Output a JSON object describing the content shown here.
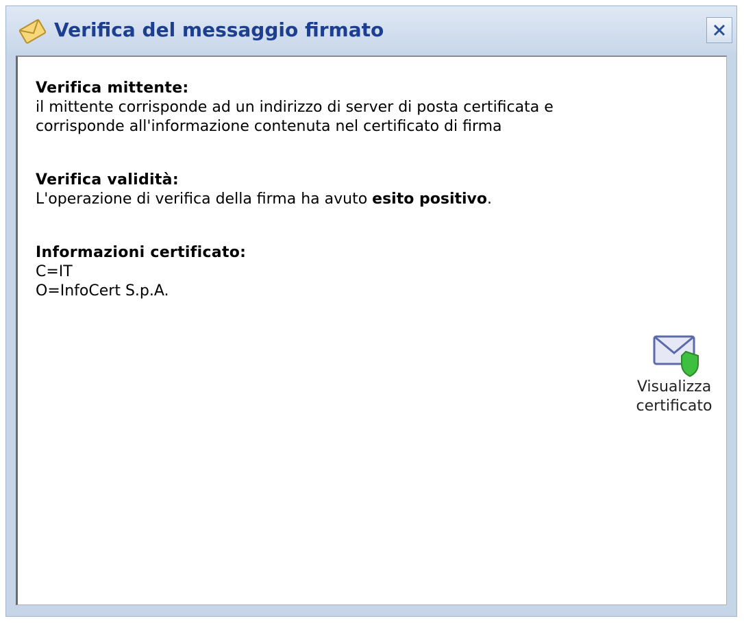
{
  "window": {
    "title": "Verifica del messaggio firmato",
    "close_label": "Close"
  },
  "sections": {
    "sender": {
      "heading": "Verifica mittente:",
      "line1": "il mittente corrisponde ad un indirizzo di server di posta certificata e",
      "line2": "corrisponde all'informazione contenuta nel certificato di firma"
    },
    "validity": {
      "heading": "Verifica validità:",
      "text_before": "L'operazione di verifica della firma ha avuto ",
      "text_bold": "esito positivo",
      "text_after": "."
    },
    "certificate": {
      "heading": "Informazioni certificato:",
      "line1": "C=IT",
      "line2": "O=InfoCert S.p.A."
    }
  },
  "cert_button": {
    "line1": "Visualizza",
    "line2": "certificato",
    "icon": "envelope-shield-icon"
  },
  "colors": {
    "title_text": "#1d3f8f",
    "titlebar_bg": "#c9d7ea",
    "shield_green": "#3fbf3f"
  }
}
